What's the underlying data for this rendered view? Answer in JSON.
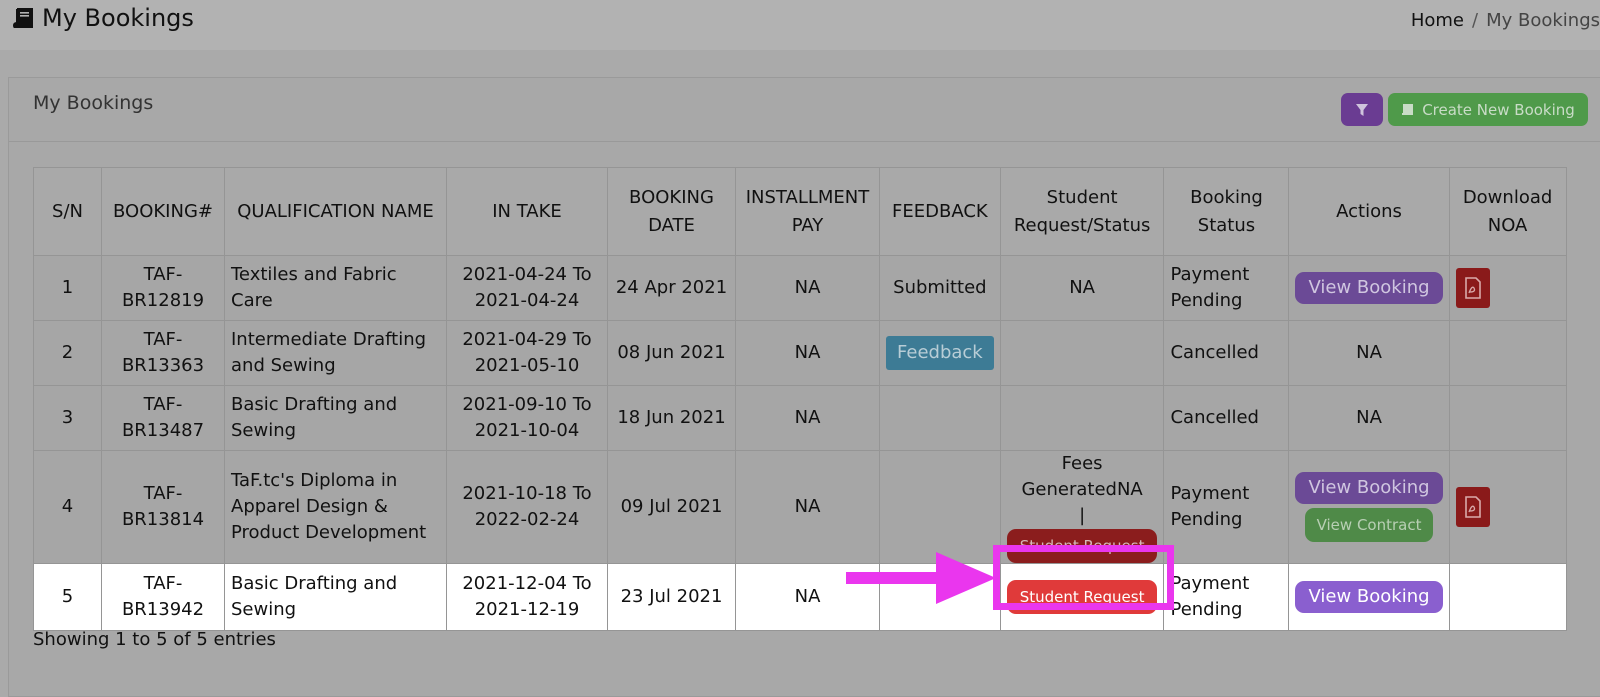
{
  "header": {
    "title": "My Bookings",
    "title_icon": "book-icon"
  },
  "breadcrumb": {
    "home": "Home",
    "separator": "/",
    "current": "My Bookings"
  },
  "card": {
    "title": "My Bookings",
    "filter_icon": "filter-icon",
    "create_button": "Create New Booking",
    "create_icon": "book-icon"
  },
  "table": {
    "columns": [
      "S/N",
      "BOOKING#",
      "QUALIFICATION NAME",
      "IN TAKE",
      "BOOKING DATE",
      "INSTALLMENT PAY",
      "FEEDBACK",
      "Student Request/Status",
      "Booking Status",
      "Actions",
      "Download NOA"
    ],
    "rows": [
      {
        "sn": "1",
        "booking": "TAF-BR12819",
        "qualification": "Textiles and Fabric Care",
        "intake": "2021-04-24 To 2021-04-24",
        "booking_date": "24 Apr 2021",
        "installment": "NA",
        "feedback": "Submitted",
        "request_status": "NA",
        "booking_status": "Payment Pending",
        "action": "View Booking",
        "noa": "pdf-icon"
      },
      {
        "sn": "2",
        "booking": "TAF-BR13363",
        "qualification": "Intermediate Drafting and Sewing",
        "intake": "2021-04-29 To 2021-05-10",
        "booking_date": "08 Jun 2021",
        "installment": "NA",
        "feedback": "Feedback",
        "request_status": "",
        "booking_status": "Cancelled",
        "action": "NA",
        "noa": ""
      },
      {
        "sn": "3",
        "booking": "TAF-BR13487",
        "qualification": "Basic Drafting and Sewing",
        "intake": "2021-09-10 To 2021-10-04",
        "booking_date": "18 Jun 2021",
        "installment": "NA",
        "feedback": "",
        "request_status": "",
        "booking_status": "Cancelled",
        "action": "NA",
        "noa": ""
      },
      {
        "sn": "4",
        "booking": "TAF-BR13814",
        "qualification": "TaF.tc's Diploma in Apparel Design & Product Development",
        "intake": "2021-10-18 To 2022-02-24",
        "booking_date": "09 Jul 2021",
        "installment": "NA",
        "feedback": "",
        "request_status": "Fees GeneratedNA |",
        "request_button": "Student Request",
        "booking_status": "Payment Pending",
        "action": "View Booking",
        "action2": "View Contract",
        "noa": "pdf-icon"
      },
      {
        "sn": "5",
        "booking": "TAF-BR13942",
        "qualification": "Basic Drafting and Sewing",
        "intake": "2021-12-04 To 2021-12-19",
        "booking_date": "23 Jul 2021",
        "installment": "NA",
        "feedback": "",
        "request_button": "Student Request",
        "booking_status": "Payment Pending",
        "action": "View Booking",
        "noa": ""
      }
    ]
  },
  "footer": {
    "entries": "Showing 1 to 5 of 5 entries"
  },
  "colors": {
    "highlight": "#ea36ee",
    "view_button": "#8a5fcf",
    "request_button": "#e03a3a",
    "create_button": "#4f9a4a"
  }
}
